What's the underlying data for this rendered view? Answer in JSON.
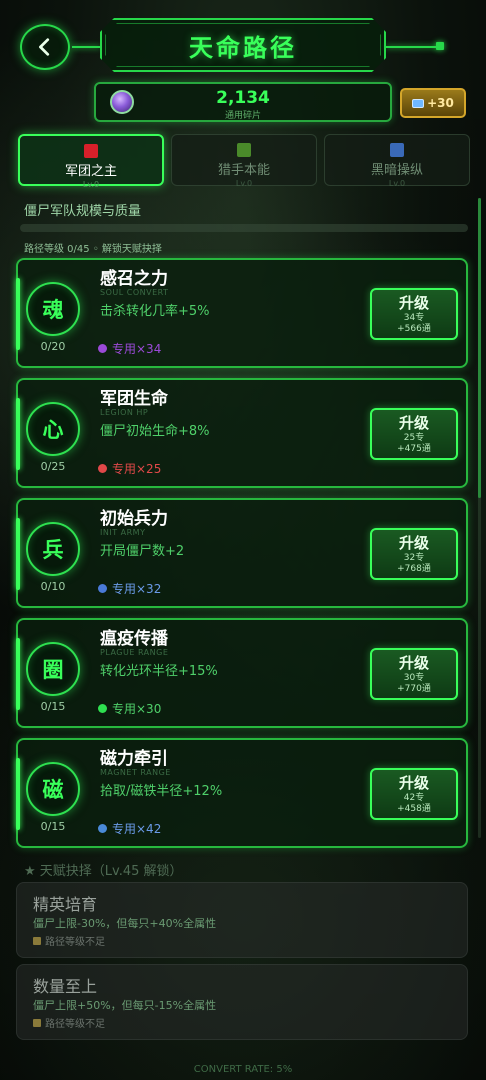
{
  "header": {
    "title": "天命路径"
  },
  "currency": {
    "value": "2,134",
    "label": "通用碎片"
  },
  "gem": {
    "label": "+30"
  },
  "tabs": [
    {
      "label": "军团之主",
      "level": "Lv.0",
      "color": "#d8202a"
    },
    {
      "label": "猎手本能",
      "level": "Lv.0",
      "color": "#4a8a2a"
    },
    {
      "label": "黑暗操纵",
      "level": "Lv.0",
      "color": "#3a6ab8"
    }
  ],
  "subtitle": "僵尸军队规模与质量",
  "path_level": "路径等级 0/45 ◦ 解锁天赋抉择",
  "skills": [
    {
      "icon": "魂",
      "count": "0/20",
      "name": "感召之力",
      "en": "SOUL CONVERT",
      "desc": "击杀转化几率+5%",
      "req": "专用×34",
      "req_color": "#9a4ad8",
      "upgrade": "升级",
      "cost": "34专",
      "gold": "+566通"
    },
    {
      "icon": "心",
      "count": "0/25",
      "name": "军团生命",
      "en": "LEGION HP",
      "desc": "僵尸初始生命+8%",
      "req": "专用×25",
      "req_color": "#e04848",
      "upgrade": "升级",
      "cost": "25专",
      "gold": "+475通"
    },
    {
      "icon": "兵",
      "count": "0/10",
      "name": "初始兵力",
      "en": "INIT ARMY",
      "desc": "开局僵尸数+2",
      "req": "专用×32",
      "req_color": "#4a7ad8",
      "upgrade": "升级",
      "cost": "32专",
      "gold": "+768通"
    },
    {
      "icon": "圈",
      "count": "0/15",
      "name": "瘟疫传播",
      "en": "PLAGUE RANGE",
      "desc": "转化光环半径+15%",
      "req": "专用×30",
      "req_color": "#2ee050",
      "upgrade": "升级",
      "cost": "30专",
      "gold": "+770通"
    },
    {
      "icon": "磁",
      "count": "0/15",
      "name": "磁力牵引",
      "en": "MAGNET RANGE",
      "desc": "拾取/磁铁半径+12%",
      "req": "专用×42",
      "req_color": "#4a8ad8",
      "upgrade": "升级",
      "cost": "42专",
      "gold": "+458通"
    }
  ],
  "talent": {
    "heading": "★ 天赋抉择（Lv.45 解锁）",
    "cards": [
      {
        "name": "精英培育",
        "desc": "僵尸上限-30%，但每只+40%全属性",
        "lock": "路径等级不足"
      },
      {
        "name": "数量至上",
        "desc": "僵尸上限+50%，但每只-15%全属性",
        "lock": "路径等级不足"
      }
    ]
  },
  "footer": "CONVERT RATE: 5%",
  "colors": {
    "accent": "#39ff5a",
    "gold": "#d4a62a"
  }
}
